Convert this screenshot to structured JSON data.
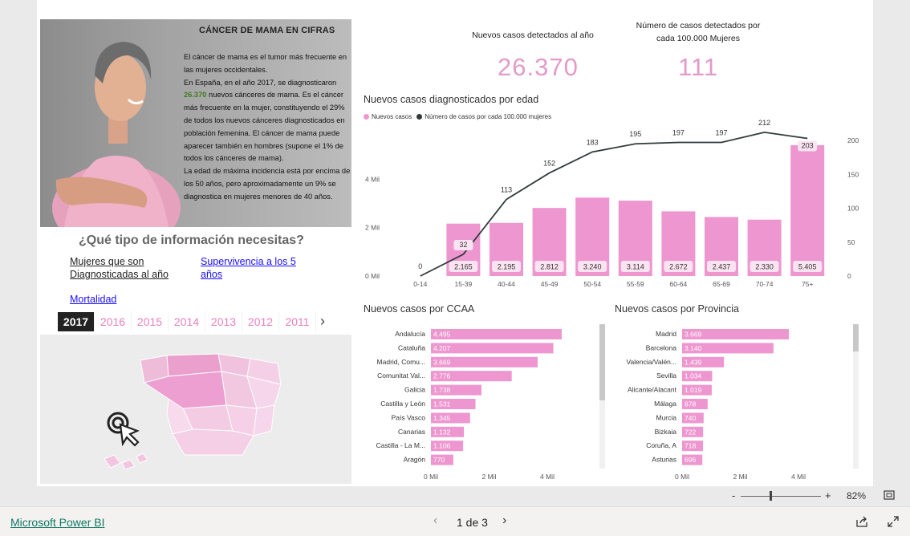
{
  "hero": {
    "title": "CÁNCER DE MAMA EN CIFRAS",
    "p1": "El cáncer de mama es el tumor más  frecuente en las mujeres occidentales.",
    "p2_pre": "En España, en el año 2017, se diagnosticaron ",
    "p2_highlight": "26.370",
    "p2_post": " nuevos cánceres de mama. Es el cáncer más frecuente en la mujer, constituyendo el 29% de todos los nuevos cánceres diagnosticados en población femenina. El cáncer de mama puede aparecer también en hombres (supone el 1% de todos los cánceres de mama).",
    "p3": "La edad de máxima incidencia está por encima de los 50 años, pero aproximadamente un 9% se diagnostica en mujeres menores de 40 años."
  },
  "question": "¿Qué tipo de información necesitas?",
  "links": {
    "diagnosed": "Mujeres que son Diagnosticadas al año",
    "survival": "Supervivencia a los 5 años",
    "mortality": "Mortalidad"
  },
  "years": [
    "2017",
    "2016",
    "2015",
    "2014",
    "2013",
    "2012",
    "2011"
  ],
  "selected_year": "2017",
  "kpis": {
    "new_cases_label": "Nuevos casos detectados al año",
    "new_cases_value": "26.370",
    "rate_label": "Número de casos detectados por cada 100.000 Mujeres",
    "rate_value": "111"
  },
  "colors": {
    "accent": "#e89acb",
    "bar": "#ee96cf",
    "line": "#2f3b3b",
    "link": "#1a0dff"
  },
  "chart_titles": {
    "age": "Nuevos casos diagnosticados por edad",
    "ccaa": "Nuevos casos por CCAA",
    "provincia": "Nuevos casos por Provincia"
  },
  "chart_data": [
    {
      "type": "bar",
      "title": "Nuevos casos diagnosticados por edad",
      "categories": [
        "0-14",
        "15-39",
        "40-44",
        "45-49",
        "50-54",
        "55-59",
        "60-64",
        "65-69",
        "70-74",
        "75+"
      ],
      "series": [
        {
          "name": "Nuevos casos",
          "kind": "bar",
          "axis": "left",
          "values": [
            0,
            2165,
            2195,
            2812,
            3240,
            3114,
            2672,
            2437,
            2330,
            5405
          ],
          "labels": [
            "",
            "2.165",
            "2.195",
            "2.812",
            "3.240",
            "3.114",
            "2.672",
            "2.437",
            "2.330",
            "5.405"
          ]
        },
        {
          "name": "Número de casos por cada 100.000 mujeres",
          "kind": "line",
          "axis": "right",
          "values": [
            0,
            32,
            113,
            152,
            183,
            195,
            197,
            197,
            212,
            203
          ]
        }
      ],
      "y_left_ticks": [
        "0 Mil",
        "2 Mil",
        "4 Mil"
      ],
      "y_left_lim": [
        0,
        6000
      ],
      "y_right_ticks": [
        "0",
        "50",
        "100",
        "150",
        "200"
      ],
      "y_right_lim": [
        0,
        220
      ],
      "legend": "top-left"
    },
    {
      "type": "bar",
      "orientation": "horizontal",
      "title": "Nuevos casos por CCAA",
      "categories": [
        "Andalucía",
        "Cataluña",
        "Madrid, Comu...",
        "Comunitat Val...",
        "Galicia",
        "Castilla y León",
        "País Vasco",
        "Canarias",
        "Castilla - La M...",
        "Aragón"
      ],
      "values": [
        4495,
        4207,
        3669,
        2776,
        1738,
        1531,
        1345,
        1132,
        1106,
        770
      ],
      "labels": [
        "4.495",
        "4.207",
        "3.669",
        "2.776",
        "1.738",
        "1.531",
        "1.345",
        "1.132",
        "1.106",
        "770"
      ],
      "x_ticks": [
        "0 Mil",
        "2 Mil",
        "4 Mil"
      ],
      "xlim": [
        0,
        4000
      ]
    },
    {
      "type": "bar",
      "orientation": "horizontal",
      "title": "Nuevos casos por Provincia",
      "categories": [
        "Madrid",
        "Barcelona",
        "Valencia/Valén...",
        "Sevilla",
        "Alicante/Alacant",
        "Málaga",
        "Murcia",
        "Bizkaia",
        "Coruña, A",
        "Asturias"
      ],
      "values": [
        3669,
        3140,
        1439,
        1034,
        1019,
        878,
        740,
        722,
        718,
        696
      ],
      "labels": [
        "3.669",
        "3.140",
        "1.439",
        "1.034",
        "1.019",
        "878",
        "740",
        "722",
        "718",
        "696"
      ],
      "x_ticks": [
        "0 Mil",
        "2 Mil",
        "4 Mil"
      ],
      "xlim": [
        0,
        4000
      ]
    }
  ],
  "statusbar": {
    "zoom_minus": "-",
    "zoom_plus": "+",
    "zoom": "82%"
  },
  "footer": {
    "brand": "Microsoft Power BI",
    "pagination": "1 de 3"
  }
}
